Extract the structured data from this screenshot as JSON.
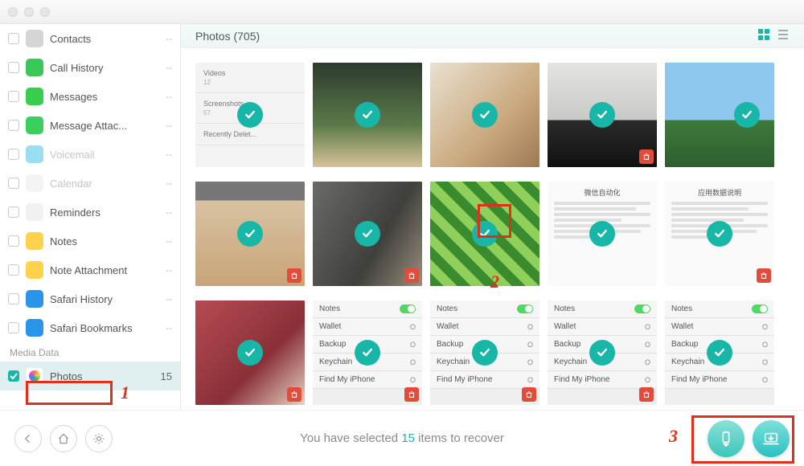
{
  "header": {
    "title": "Photos (705)"
  },
  "sidebar": {
    "personal": [
      {
        "label": "Contacts",
        "icon_bg": "#d5d5d5",
        "enabled": true
      },
      {
        "label": "Call History",
        "icon_bg": "#3ac659",
        "enabled": true
      },
      {
        "label": "Messages",
        "icon_bg": "#38ce4d",
        "enabled": true
      },
      {
        "label": "Message Attac...",
        "icon_bg": "#3bd05e",
        "enabled": true
      },
      {
        "label": "Voicemail",
        "icon_bg": "#9adff0",
        "enabled": false
      },
      {
        "label": "Calendar",
        "icon_bg": "#f4f4f4",
        "enabled": false
      },
      {
        "label": "Reminders",
        "icon_bg": "#f1f1f1",
        "enabled": true
      },
      {
        "label": "Notes",
        "icon_bg": "#ffd24c",
        "enabled": true
      },
      {
        "label": "Note Attachment",
        "icon_bg": "#ffd24c",
        "enabled": true
      },
      {
        "label": "Safari History",
        "icon_bg": "#2a94e8",
        "enabled": true
      },
      {
        "label": "Safari Bookmarks",
        "icon_bg": "#2a94e8",
        "enabled": true
      }
    ],
    "media_section_label": "Media Data",
    "media": [
      {
        "label": "Photos",
        "count": "15",
        "selected": true
      }
    ]
  },
  "grid": {
    "settings_labels": {
      "notes": "Notes",
      "wallet": "Wallet",
      "backup": "Backup",
      "keychain": "Keychain",
      "findiphone": "Find My iPhone",
      "on": "O"
    },
    "syslist": {
      "videos": "Videos",
      "screenshots": "Screenshots",
      "recent": "Recently Delet..."
    }
  },
  "footer": {
    "status_prefix": "You have selected ",
    "status_count": "15",
    "status_suffix": " items to recover"
  },
  "annotations": {
    "one": "1",
    "two": "2",
    "three": "3"
  }
}
